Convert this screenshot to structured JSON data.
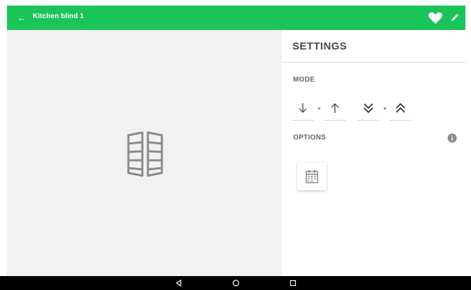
{
  "app": {
    "title": "Kitchen blind 1",
    "accent_color": "#1bc458"
  },
  "header": {
    "back_icon": "arrow-left-icon",
    "favorite_icon": "heart-icon",
    "edit_icon": "pencil-icon"
  },
  "main": {
    "device_icon": "window-blind-icon"
  },
  "settings": {
    "title": "SETTINGS",
    "mode_label": "MODE",
    "modes": [
      {
        "name": "down",
        "icon": "arrow-down-icon"
      },
      {
        "name": "up",
        "icon": "arrow-up-icon"
      },
      {
        "name": "double-down",
        "icon": "double-chevron-down-icon"
      },
      {
        "name": "double-up",
        "icon": "double-chevron-up-icon"
      }
    ],
    "options_label": "OPTIONS",
    "info_icon": "info-icon",
    "calendar_icon": "calendar-icon"
  },
  "system_nav": {
    "back": "nav-back-icon",
    "home": "nav-home-icon",
    "recents": "nav-recents-icon"
  }
}
